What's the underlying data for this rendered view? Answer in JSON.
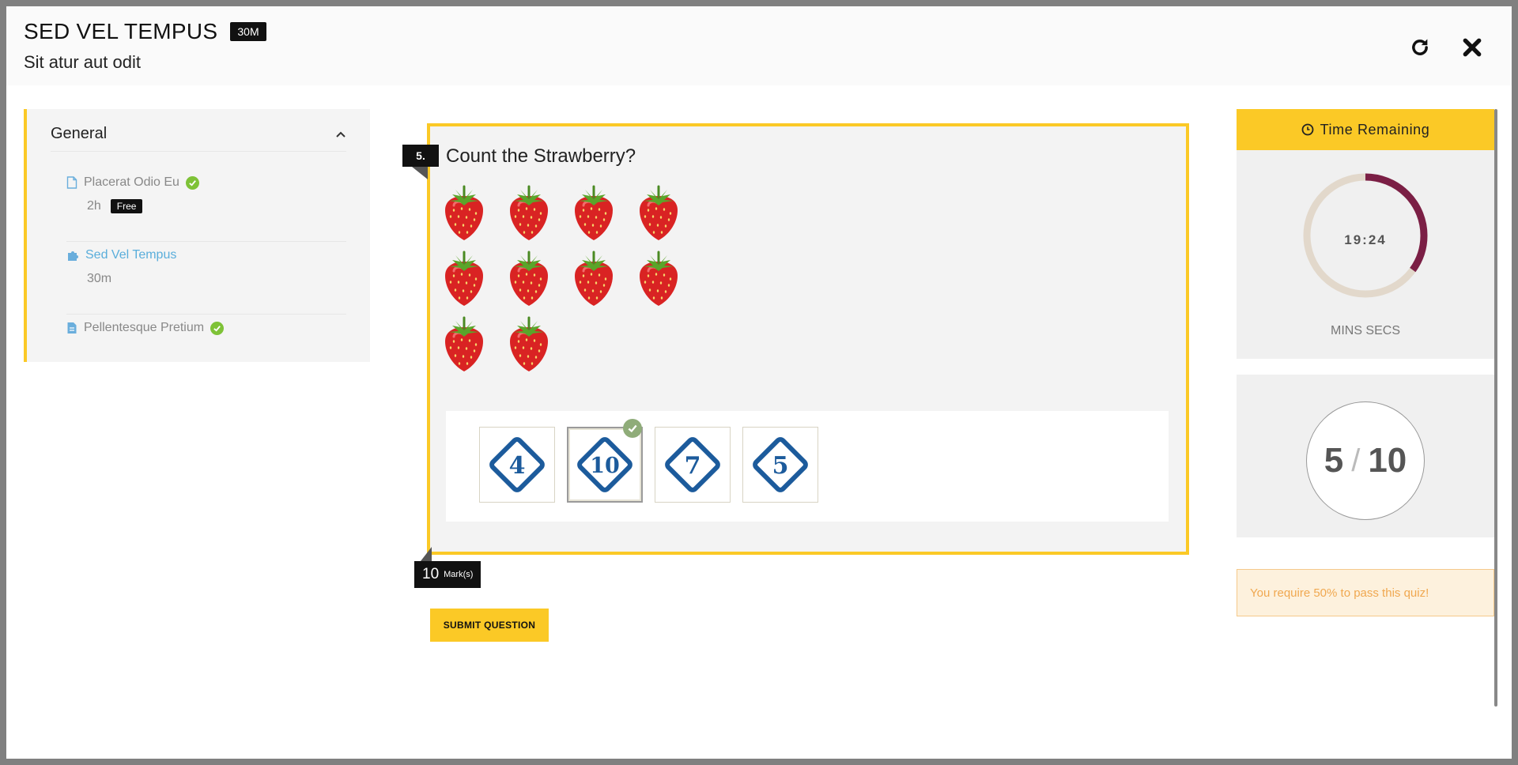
{
  "header": {
    "title": "SED VEL TEMPUS",
    "duration_badge": "30M",
    "subtitle": "Sit atur aut odit",
    "reload_icon": "reload-icon",
    "close_icon": "close-icon"
  },
  "sidebar": {
    "section_label": "General",
    "items": [
      {
        "name": "Placerat Odio Eu",
        "icon": "document-icon",
        "duration": "2h",
        "badge": "Free",
        "completed": true
      },
      {
        "name": "Sed Vel Tempus",
        "icon": "puzzle-icon",
        "duration": "30m",
        "active": true
      },
      {
        "name": "Pellentesque Pretium",
        "icon": "document-filled-icon",
        "completed": true
      }
    ]
  },
  "question": {
    "number": "5.",
    "text": "Count the Strawberry?",
    "strawberry_count": 10,
    "answers": [
      {
        "value": "4",
        "selected": false
      },
      {
        "value": "10",
        "selected": true
      },
      {
        "value": "7",
        "selected": false
      },
      {
        "value": "5",
        "selected": false
      }
    ],
    "marks": "10",
    "marks_unit": "Mark(s)",
    "submit_label": "SUBMIT QUESTION"
  },
  "timer": {
    "header": "Time Remaining",
    "value": "19:24",
    "caption": "MINS SECS",
    "progress_fraction": 0.35
  },
  "score": {
    "current": "5",
    "separator": "/",
    "total": "10"
  },
  "pass_note": "You require 50% to pass this quiz!",
  "colors": {
    "accent": "#fbc926",
    "timer_arc": "#7b1f45",
    "timer_track": "#e2d8cb",
    "check_green": "#7ec237",
    "active_link": "#5aaedb"
  }
}
